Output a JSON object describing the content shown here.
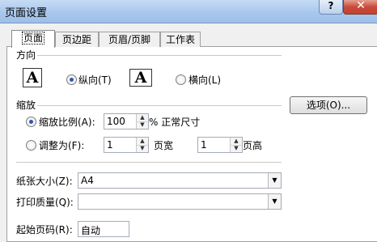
{
  "window": {
    "title": "页面设置",
    "help_label": "?",
    "close_label": "✕"
  },
  "tabs": [
    {
      "label": "页面"
    },
    {
      "label": "页边距"
    },
    {
      "label": "页眉/页脚"
    },
    {
      "label": "工作表"
    }
  ],
  "orientation": {
    "section_label": "方向",
    "portrait_icon_glyph": "A",
    "portrait_label": "纵向(T)",
    "portrait_selected": true,
    "landscape_icon_glyph": "A",
    "landscape_label": "横向(L)",
    "landscape_selected": false
  },
  "scaling": {
    "section_label": "缩放",
    "adjust_label": "缩放比例(A):",
    "adjust_value": "100",
    "adjust_suffix": "% 正常尺寸",
    "adjust_selected": true,
    "fit_label": "调整为(F):",
    "fit_selected": false,
    "fit_wide_value": "1",
    "fit_wide_suffix": "页宽",
    "fit_tall_value": "1",
    "fit_tall_suffix": "页高"
  },
  "options_button_label": "选项(O)...",
  "paper_size": {
    "label": "纸张大小(Z):",
    "value": "A4"
  },
  "print_quality": {
    "label": "打印质量(Q):",
    "value": ""
  },
  "first_page": {
    "label": "起始页码(R):",
    "value": "自动"
  }
}
